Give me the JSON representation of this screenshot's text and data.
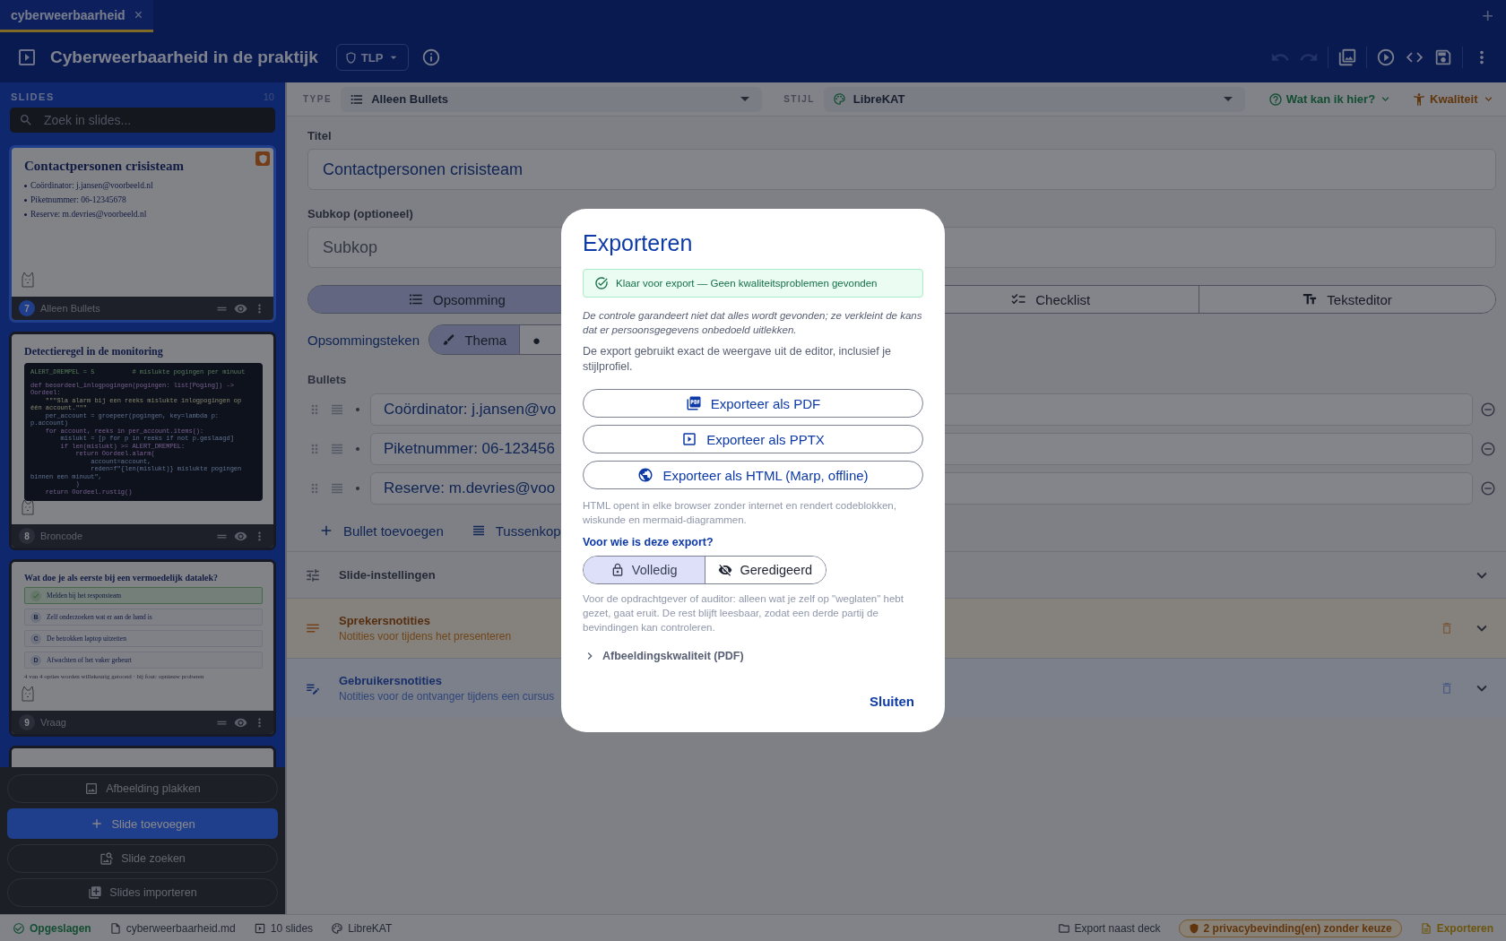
{
  "tab_strip": {
    "tabs": [
      {
        "label": "cyberweerbaarheid",
        "close": "×",
        "selected": true
      }
    ],
    "new_tab": "+"
  },
  "header": {
    "title": "Cyberweerbaarheid in de praktijk",
    "tlp": "TLP",
    "tools": [
      {
        "kind": "undo",
        "disabled": true
      },
      {
        "kind": "redo",
        "disabled": true
      },
      {
        "kind": "sep"
      },
      {
        "kind": "images",
        "disabled": false
      },
      {
        "kind": "sep"
      },
      {
        "kind": "play",
        "disabled": false
      },
      {
        "kind": "code",
        "disabled": false
      },
      {
        "kind": "save",
        "disabled": false
      },
      {
        "kind": "sep"
      },
      {
        "kind": "more",
        "disabled": false
      }
    ]
  },
  "sidebar": {
    "heading": "SLIDES",
    "count": "10",
    "search": {
      "placeholder": "Zoek in slides..."
    },
    "slides": [
      {
        "kind": "bullets",
        "number": "7",
        "label": "Alleen Bullets",
        "selected": true,
        "privacy_flag": true,
        "title": "Contactpersonen crisisteam",
        "bullets": [
          "Coördinator: j.jansen@voorbeeld.nl",
          "Piketnummer: 06-12345678",
          "Reserve: m.devries@voorbeeld.nl"
        ]
      },
      {
        "kind": "code",
        "number": "8",
        "label": "Broncode",
        "selected": false,
        "privacy_flag": false,
        "title": "Detectieregel in de monitoring",
        "code": [
          [
            "ALERT_DREMPEL = 5          # mislukte pogingen per minuut"
          ],
          [
            "def beoordeel_inlogpogingen(pogingen: list[Poging]) -> Oordeel:",
            "    \"\"\"Sla alarm bij een reeks mislukte inlogpogingen op één account.\"\"\"",
            "    per_account = groepeer(pogingen, key=lambda p: p.account)",
            "    for account, reeks in per_account.items():",
            "        mislukt = [p for p in reeks if not p.geslaagd]",
            "        if len(mislukt) >= ALERT_DREMPEL:",
            "            return Oordeel.alarm(",
            "                account=account,",
            "                reden=f\"{len(mislukt)} mislukte pogingen binnen een minuut\",",
            "            )",
            "    return Oordeel.rustig()"
          ]
        ]
      },
      {
        "kind": "quiz",
        "number": "9",
        "label": "Vraag",
        "selected": false,
        "privacy_flag": false,
        "title": "Wat doe je als eerste bij een vermoedelijk datalek?",
        "options": [
          {
            "text": "Melden bij het responsteam",
            "selected": true
          },
          {
            "letter": "B",
            "text": "Zelf onderzoeken wat er aan de hand is",
            "selected": false
          },
          {
            "letter": "C",
            "text": "De betrokken laptop uitzetten",
            "selected": false
          },
          {
            "letter": "D",
            "text": "Afwachten of het vaker gebeurt",
            "selected": false
          }
        ],
        "note": "4 van 4 opties worden willekeurig getoond · bij fout: opnieuw proberen"
      },
      {
        "kind": "blank",
        "selected": false
      }
    ],
    "actions": [
      {
        "kind": "paste",
        "label": "Afbeelding plakken"
      },
      {
        "kind": "add",
        "label": "Slide toevoegen"
      },
      {
        "kind": "find",
        "label": "Slide zoeken"
      },
      {
        "kind": "import",
        "label": "Slides importeren"
      }
    ]
  },
  "toolbar": {
    "type_label": "TYPE",
    "type_value": "Alleen Bullets",
    "style_label": "STIJL",
    "style_value": "LibreKAT",
    "help": "Wat kan ik hier?",
    "quality": "Kwaliteit"
  },
  "editor": {
    "title_label": "Titel",
    "title_value": "Contactpersonen crisisteam",
    "subtitle_label": "Subkop (optioneel)",
    "subtitle_placeholder": "Subkop",
    "modes": [
      {
        "kind": "list",
        "label": "Opsomming",
        "selected": true
      },
      {
        "kind": "checklist",
        "label": "Checklist",
        "selected": false
      },
      {
        "kind": "text",
        "label": "Teksteditor",
        "selected": false
      }
    ],
    "bullet_style_label": "Opsommingsteken",
    "bullet_styles": [
      {
        "kind": "theme",
        "label": "Thema",
        "selected": true
      },
      {
        "kind": "dot",
        "label": "●",
        "selected": false
      }
    ],
    "bullets_label": "Bullets",
    "bullets": [
      "Coördinator: j.jansen@vo",
      "Piketnummer: 06-123456",
      "Reserve: m.devries@voo"
    ],
    "add_bullet": "Bullet toevoegen",
    "add_heading": "Tussenkop",
    "sections": [
      {
        "kind": "settings",
        "title": "Slide-instellingen"
      },
      {
        "kind": "speaker",
        "title": "Sprekersnotities",
        "subtitle": "Notities voor tijdens het presenteren"
      },
      {
        "kind": "user",
        "title": "Gebruikersnotities",
        "subtitle": "Notities voor de ontvanger tijdens een cursus"
      }
    ]
  },
  "status_bar": {
    "left": [
      {
        "kind": "saved",
        "label": "Opgeslagen"
      },
      {
        "kind": "file",
        "label": "cyberweerbaarheid.md"
      },
      {
        "kind": "slides",
        "label": "10 slides"
      },
      {
        "kind": "style",
        "label": "LibreKAT"
      }
    ],
    "right": [
      {
        "kind": "folder",
        "label": "Export naast deck"
      },
      {
        "kind": "privacy",
        "label": "2 privacybevinding(en) zonder keuze"
      },
      {
        "kind": "export",
        "label": "Exporteren"
      }
    ]
  },
  "modal": {
    "title": "Exporteren",
    "status": "Klaar voor export — Geen kwaliteitsproblemen gevonden",
    "disclaimer": "De controle garandeert niet dat alles wordt gevonden; ze verkleint de kans dat er persoonsgegevens onbedoeld uitlekken.",
    "intro": "De export gebruikt exact de weergave uit de editor, inclusief je stijlprofiel.",
    "buttons": [
      {
        "kind": "pdf",
        "label": "Exporteer als PDF"
      },
      {
        "kind": "pptx",
        "label": "Exporteer als PPTX"
      },
      {
        "kind": "html",
        "label": "Exporteer als HTML (Marp, offline)"
      }
    ],
    "html_note": "HTML opent in elke browser zonder internet en rendert codeblokken, wiskunde en mermaid-diagrammen.",
    "audience_label": "Voor wie is deze export?",
    "audience": [
      {
        "kind": "full",
        "label": "Volledig",
        "selected": true
      },
      {
        "kind": "redacted",
        "label": "Geredigeerd",
        "selected": false
      }
    ],
    "audience_note": "Voor de opdrachtgever of auditor: alleen wat je zelf op \"weglaten\" hebt gezet, gaat eruit. De rest blijft leesbaar, zodat een derde partij de bevindingen kan controleren.",
    "expander": {
      "label": "Afbeeldingskwaliteit (PDF)",
      "expanded": false
    },
    "close": "Sluiten"
  }
}
